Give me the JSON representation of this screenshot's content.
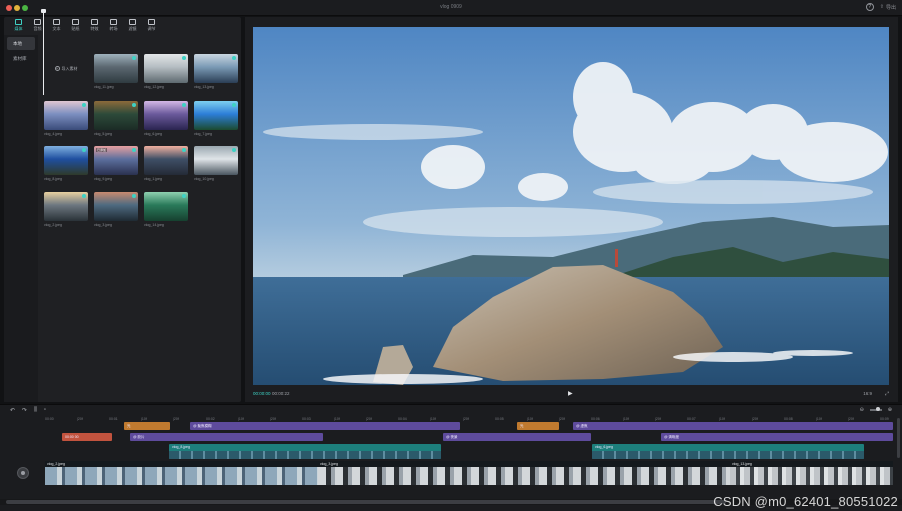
{
  "window": {
    "title": "vlog 0909"
  },
  "titlebar": {
    "help_icon": "?",
    "export_label": "导出"
  },
  "toolbar": {
    "tools": [
      {
        "label": "媒体",
        "icon": "media-icon",
        "active": true
      },
      {
        "label": "音频",
        "icon": "audio-icon"
      },
      {
        "label": "文本",
        "icon": "text-icon"
      },
      {
        "label": "贴纸",
        "icon": "sticker-icon"
      },
      {
        "label": "特效",
        "icon": "effects-icon"
      },
      {
        "label": "转场",
        "icon": "transition-icon"
      },
      {
        "label": "滤镜",
        "icon": "filter-icon"
      },
      {
        "label": "调节",
        "icon": "adjust-icon"
      }
    ]
  },
  "subnav": {
    "items": [
      "本地",
      "素材库"
    ],
    "active": 0
  },
  "media": {
    "import_label": "导入素材",
    "items": [
      {
        "name": "vlog_11.jpeg",
        "colors": [
          "#5b6770",
          "#9fb2bd",
          "#2f3b40"
        ]
      },
      {
        "name": "vlog_12.jpeg",
        "colors": [
          "#b5bdc2",
          "#e3e6e8",
          "#5e6a70"
        ]
      },
      {
        "name": "vlog_13.jpeg",
        "colors": [
          "#7a9ab5",
          "#c9d6e0",
          "#2b3e55"
        ]
      },
      {
        "name": "vlog_4.jpeg",
        "colors": [
          "#7c8fc0",
          "#e0c7d2",
          "#3a4b7a"
        ]
      },
      {
        "name": "vlog_5.jpeg",
        "colors": [
          "#2d4a3a",
          "#8c6a3a",
          "#1b2b25"
        ]
      },
      {
        "name": "vlog_6.jpeg",
        "colors": [
          "#6b5a9c",
          "#d3b8e6",
          "#2a2450"
        ]
      },
      {
        "name": "vlog_7.jpeg",
        "colors": [
          "#2d7ed8",
          "#7dd0f0",
          "#1b4a2f"
        ]
      },
      {
        "name": "vlog_8.jpeg",
        "colors": [
          "#1f4fa0",
          "#7fb0e0",
          "#2e3a2a"
        ]
      },
      {
        "name": "vlog_9.jpeg",
        "colors": [
          "#5c6f9e",
          "#e6a0a0",
          "#2a3150"
        ],
        "tag": "已添加"
      },
      {
        "name": "vlog_1.jpeg",
        "colors": [
          "#3f4f66",
          "#f0b0a0",
          "#242a36"
        ]
      },
      {
        "name": "vlog_10.jpeg",
        "colors": [
          "#dfe4e8",
          "#9aa7b0",
          "#4a5660"
        ]
      },
      {
        "name": "vlog_2.jpeg",
        "colors": [
          "#6d7780",
          "#e8d0a0",
          "#2a3238"
        ]
      },
      {
        "name": "vlog_3.jpeg",
        "colors": [
          "#4e6a80",
          "#c88a70",
          "#1e2a33"
        ]
      },
      {
        "name": "vlog_14.jpeg",
        "colors": [
          "#2a7a5a",
          "#8fd0b0",
          "#16402f"
        ]
      }
    ]
  },
  "player": {
    "timecode_current": "00:00:00",
    "timecode_total": "00:00:22",
    "aspect_ratio": "16:9",
    "play_icon": "▶",
    "fullscreen_icon": "⤢"
  },
  "timeline": {
    "ruler_ticks": [
      "00:00",
      "|20f",
      "00:01",
      "|10f",
      "|20f",
      "00:02",
      "|10f",
      "|20f",
      "00:03",
      "|10f",
      "|20f",
      "00:04",
      "|10f",
      "|20f",
      "00:05",
      "|10f",
      "|20f",
      "00:06",
      "|10f",
      "|20f",
      "00:07",
      "|10f",
      "|20f",
      "00:08",
      "|10f",
      "|20f",
      "00:09"
    ],
    "tracks": {
      "effects_row1": [
        {
          "label": "光",
          "color": "orange",
          "start": 124,
          "width": 46
        },
        {
          "label": "@ 聚焦模糊",
          "color": "purple",
          "start": 190,
          "width": 270
        },
        {
          "label": "光",
          "color": "orange",
          "start": 517,
          "width": 42
        },
        {
          "label": "@ 虚焦",
          "color": "purple",
          "start": 573,
          "width": 320
        }
      ],
      "filter_row": [
        {
          "label": "00:00 00",
          "color": "red",
          "start": 62,
          "width": 50
        },
        {
          "label": "@ 胶片",
          "color": "purple",
          "start": 130,
          "width": 193
        },
        {
          "label": "@ 夜景",
          "color": "purple",
          "start": 443,
          "width": 148
        },
        {
          "label": "@ 清晰度",
          "color": "purple",
          "start": 661,
          "width": 232
        }
      ],
      "overlay_row": [
        {
          "label": "vlog_8.jpeg",
          "color": "teal",
          "start": 169,
          "width": 272
        },
        {
          "label": "vlog_6.jpeg",
          "color": "teal",
          "start": 592,
          "width": 272
        }
      ],
      "main_row": [
        {
          "label": "vlog_2.jpeg",
          "frames": "a",
          "start": 0,
          "width": 273
        },
        {
          "label": "vlog_3.jpeg",
          "frames": "b",
          "start": 273,
          "width": 412
        },
        {
          "label": "vlog_13.jpeg",
          "frames": "c",
          "start": 685,
          "width": 163
        }
      ]
    }
  },
  "watermark": {
    "text": "CSDN @m0_62401_80551022"
  }
}
